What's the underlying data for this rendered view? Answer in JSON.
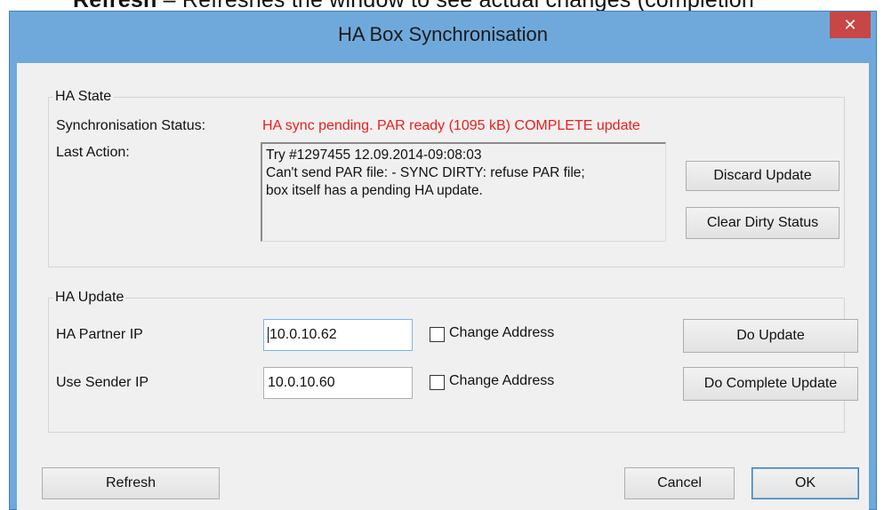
{
  "background_text": {
    "bold": "Refresh",
    "rest": " – Refreshes the window to see actual changes (completion"
  },
  "window": {
    "title": "HA Box Synchronisation",
    "close_glyph": "✕"
  },
  "ha_state": {
    "group_label": "HA State",
    "sync_status_label": "Synchronisation Status:",
    "sync_status_value": "HA sync pending. PAR ready (1095 kB)  COMPLETE update",
    "status_color": "#ee1c1c",
    "last_action_label": "Last Action:",
    "last_action_lines": [
      "Try #1297455 12.09.2014-09:08:03",
      "Can't send PAR file: - SYNC DIRTY: refuse PAR file;",
      "box itself has a pending HA update."
    ],
    "discard_button": "Discard Update",
    "clear_dirty_button": "Clear Dirty Status"
  },
  "ha_update": {
    "group_label": "HA Update",
    "partner_ip_label": "HA Partner IP",
    "partner_ip_value": "10.0.10.62",
    "sender_ip_label": "Use Sender IP",
    "sender_ip_value": "10.0.10.60",
    "change_address_label": "Change Address",
    "do_update_button": "Do Update",
    "do_complete_update_button": "Do Complete Update"
  },
  "footer": {
    "refresh_button": "Refresh",
    "cancel_button": "Cancel",
    "ok_button": "OK"
  }
}
